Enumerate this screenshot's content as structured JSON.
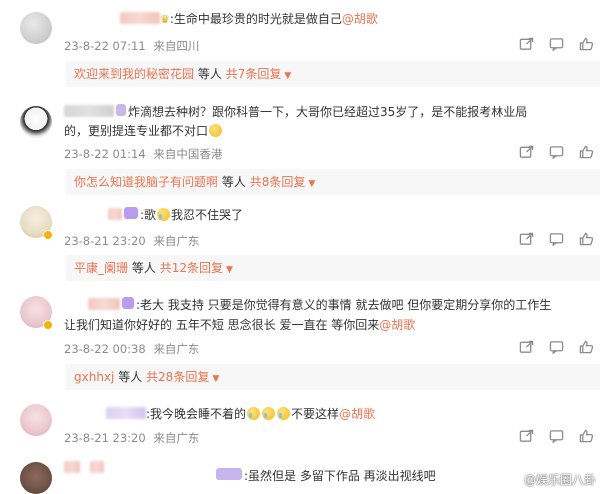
{
  "comments": [
    {
      "text": ":生命中最珍贵的时光就是做自己",
      "mention": "@胡歌",
      "time": "23-8-22 07:11",
      "location": "来自四川",
      "reply_name": "欢迎来到我的秘密花园",
      "reply_mid": "等人",
      "reply_total": "共7条回复"
    },
    {
      "text_line1": "炸滴想去种树？跟你科普一下，大哥你已经超过35岁了，是不能报考林业局",
      "text_line2": "的，更别提连专业都不对口",
      "time": "23-8-22 01:14",
      "location": "来自中国香港",
      "reply_name": "你怎么知道我脑子有问题啊",
      "reply_mid": "等人",
      "reply_total": "共8条回复"
    },
    {
      "text_a": ":歌",
      "text_b": "我忍不住哭了",
      "time": "23-8-21 23:20",
      "location": "来自广东",
      "reply_name": "平康_阑珊",
      "reply_mid": "等人",
      "reply_total": "共12条回复"
    },
    {
      "text_line1": ":老大 我支持 只要是你觉得有意义的事情 就去做吧 但你要定期分享你的工作生",
      "text_line2": "让我们知道你好好的  五年不短  思念很长  爱一直在  等你回来",
      "mention": "@胡歌",
      "time": "23-8-22 00:38",
      "location": "来自广东",
      "reply_name": "gxhhxj",
      "reply_mid": "等人",
      "reply_total": "共28条回复"
    },
    {
      "text_a": ":我今晚会睡不着的",
      "text_b": "不要这样",
      "mention": "@胡歌",
      "time": "23-8-21 23:20",
      "location": "来自广东"
    },
    {
      "text": ":虽然但是 多留下作品 再淡出视线吧"
    }
  ],
  "watermark": "@娱乐圈八卦"
}
